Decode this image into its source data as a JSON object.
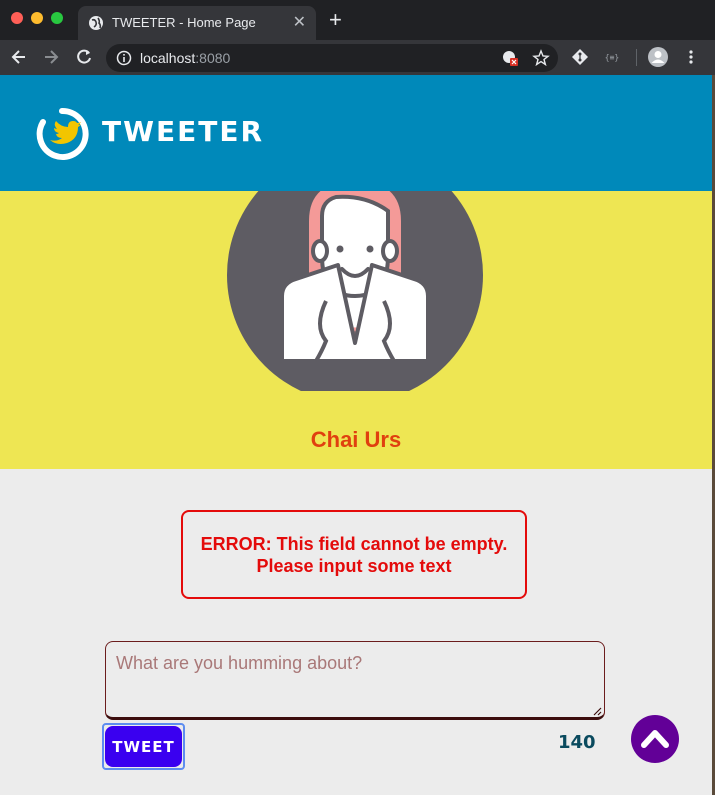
{
  "browser": {
    "tab_title": "TWEETER - Home Page",
    "tab_close": "✕",
    "new_tab": "+",
    "url_host": "localhost",
    "url_port": ":8080"
  },
  "header": {
    "brand": "TWEETER"
  },
  "profile": {
    "name": "Chai Urs"
  },
  "error": {
    "message": "ERROR: This field cannot be empty. Please input some text"
  },
  "composer": {
    "placeholder": "What are you humming about?",
    "value": "",
    "tweet_label": "TWEET",
    "char_count": "140"
  },
  "colors": {
    "header_bg": "#0089ba",
    "profile_bg": "#eee653",
    "name_color": "#e0400f",
    "error_color": "#e40b0b",
    "button_bg": "#3a00f0",
    "scroll_top_bg": "#620097"
  },
  "icons": {
    "tab": "globe-icon",
    "logo": "twitter-bird-icon",
    "scroll_top": "chevron-up-icon"
  }
}
